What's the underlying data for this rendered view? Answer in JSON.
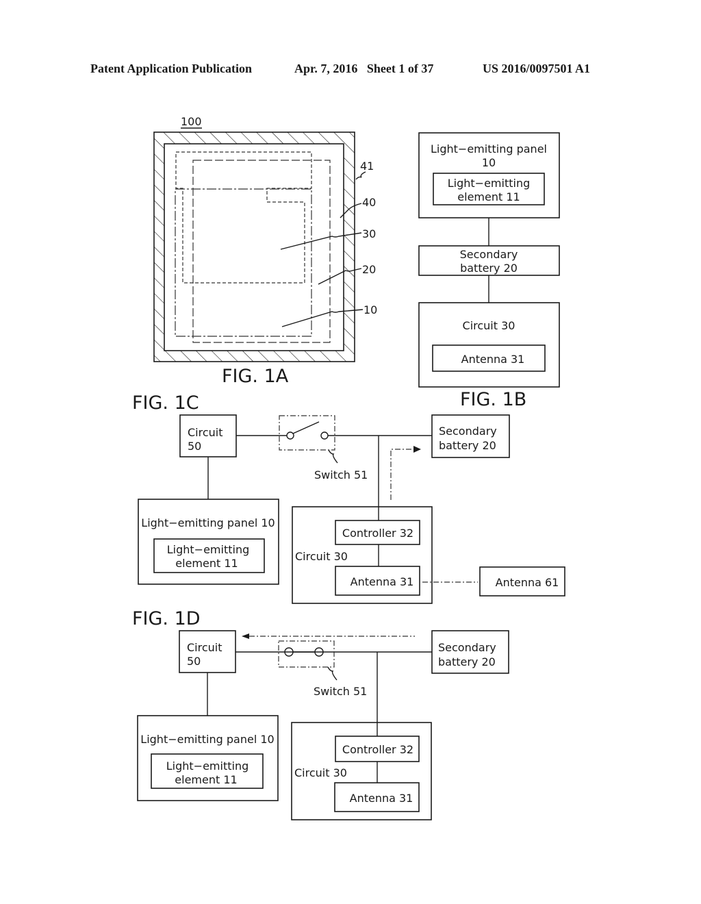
{
  "header": {
    "left": "Patent Application Publication",
    "center": "Apr. 7, 2016   Sheet 1 of 37",
    "right": "US 2016/0097501 A1"
  },
  "fig1a": {
    "title": "FIG. 1A",
    "device_ref": "100",
    "refs": [
      "41",
      "40",
      "30",
      "20",
      "10"
    ]
  },
  "fig1b": {
    "title": "FIG. 1B",
    "panel_line1": "Light−emitting panel",
    "panel_line2": "10",
    "element_line1": "Light−emitting",
    "element_line2": "element 11",
    "battery_line1": "Secondary",
    "battery_line2": "battery 20",
    "circuit": "Circuit 30",
    "antenna": "Antenna 31"
  },
  "fig1c": {
    "title": "FIG. 1C",
    "circuit50_line1": "Circuit",
    "circuit50_line2": "50",
    "switch": "Switch 51",
    "battery_line1": "Secondary",
    "battery_line2": "battery 20",
    "panel": "Light−emitting panel 10",
    "element_line1": "Light−emitting",
    "element_line2": "element 11",
    "controller": "Controller 32",
    "circuit30": "Circuit 30",
    "antenna31": "Antenna 31",
    "antenna61": "Antenna 61"
  },
  "fig1d": {
    "title": "FIG. 1D",
    "circuit50_line1": "Circuit",
    "circuit50_line2": "50",
    "switch": "Switch 51",
    "battery_line1": "Secondary",
    "battery_line2": "battery 20",
    "panel": "Light−emitting panel 10",
    "element_line1": "Light−emitting",
    "element_line2": "element 11",
    "controller": "Controller 32",
    "circuit30": "Circuit 30",
    "antenna31": "Antenna 31"
  }
}
